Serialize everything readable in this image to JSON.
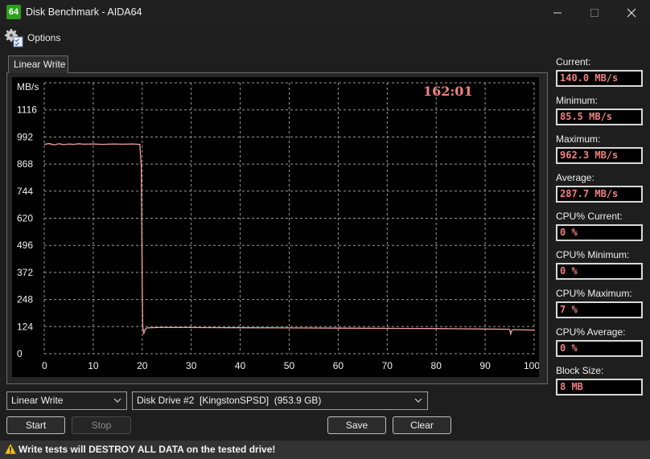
{
  "window": {
    "app_icon_text": "64",
    "title": "Disk Benchmark - AIDA64"
  },
  "menu": {
    "options_label": "Options"
  },
  "tab": {
    "label": "Linear Write"
  },
  "chart_data": {
    "type": "line",
    "timer": "162:01",
    "ylabel": "MB/s",
    "y_ticks": [
      0,
      124,
      248,
      372,
      496,
      620,
      744,
      868,
      992,
      1116
    ],
    "x_ticks": [
      "0",
      "10",
      "20",
      "30",
      "40",
      "50",
      "60",
      "70",
      "80",
      "90",
      "100 %"
    ],
    "ylim": [
      0,
      1240
    ],
    "xlim": [
      0,
      100
    ],
    "grid": true,
    "line_color": "#f4a0a0",
    "series": [
      {
        "x": [
          0,
          1,
          2,
          3,
          4,
          5,
          6,
          7,
          8,
          10,
          12,
          14,
          16,
          18,
          19.5,
          19.8,
          20,
          20.1,
          20.3,
          20.6,
          21,
          23,
          30,
          40,
          50,
          60,
          70,
          80,
          85,
          90,
          95,
          95.2,
          95.4,
          95.6,
          96,
          98,
          100
        ],
        "y": [
          958,
          962,
          956,
          961,
          957,
          960,
          958,
          961,
          959,
          960,
          958,
          960,
          959,
          960,
          958,
          860,
          320,
          130,
          90,
          112,
          118,
          120,
          120,
          119,
          118,
          117,
          116,
          115,
          114,
          113,
          112,
          90,
          105,
          110,
          110,
          109,
          108
        ]
      }
    ]
  },
  "stats": [
    {
      "label": "Current:",
      "value": "140.0 MB/s"
    },
    {
      "label": "Minimum:",
      "value": "85.5 MB/s"
    },
    {
      "label": "Maximum:",
      "value": "962.3 MB/s"
    },
    {
      "label": "Average:",
      "value": "287.7 MB/s"
    },
    {
      "label": "CPU% Current:",
      "value": "0 %"
    },
    {
      "label": "CPU% Minimum:",
      "value": "0 %"
    },
    {
      "label": "CPU% Maximum:",
      "value": "7 %"
    },
    {
      "label": "CPU% Average:",
      "value": "0 %"
    },
    {
      "label": "Block Size:",
      "value": "8 MB"
    }
  ],
  "controls": {
    "test_select": "Linear Write",
    "drive_select": "Disk Drive #2  [KingstonSPSD]  (953.9 GB)",
    "start": "Start",
    "stop": "Stop",
    "save": "Save",
    "clear": "Clear"
  },
  "warning": "Write tests will DESTROY ALL DATA on the tested drive!"
}
